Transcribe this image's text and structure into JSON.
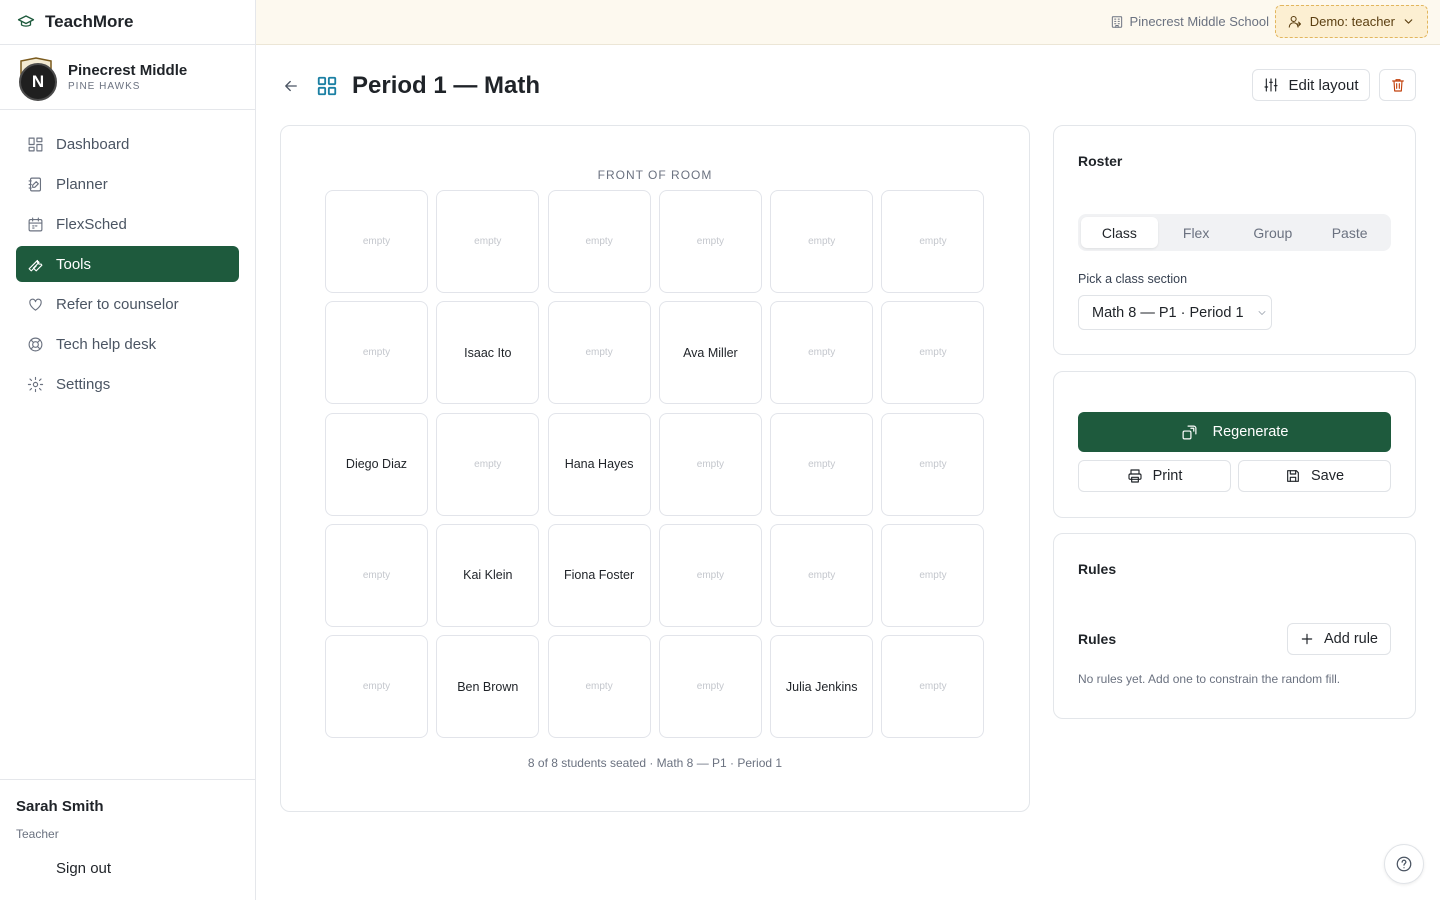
{
  "app": {
    "name": "TeachMore",
    "brand_color": "#1e5a3d",
    "school_name": "Pinecrest Middle",
    "school_subtitle": "PINE HAWKS"
  },
  "sidebar": {
    "items": [
      {
        "label": "Dashboard",
        "icon": "dashboard-icon",
        "active": false
      },
      {
        "label": "Planner",
        "icon": "planner-icon",
        "active": false
      },
      {
        "label": "FlexSched",
        "icon": "calendar-icon",
        "active": false
      },
      {
        "label": "Tools",
        "icon": "wrench-icon",
        "active": true
      },
      {
        "label": "Refer to counselor",
        "icon": "heart-icon",
        "active": false
      },
      {
        "label": "Tech help desk",
        "icon": "lifebuoy-icon",
        "active": false
      },
      {
        "label": "Settings",
        "icon": "gear-icon",
        "active": false
      }
    ],
    "user": {
      "name": "Sarah Smith",
      "role": "Teacher",
      "signout_label": "Sign out",
      "badge": "N"
    }
  },
  "topbar": {
    "school": "Pinecrest Middle School",
    "demo_label": "Demo: teacher"
  },
  "header": {
    "title": "Period 1 — Math",
    "edit_label": "Edit layout"
  },
  "seating": {
    "front_label": "FRONT OF ROOM",
    "empty_label": "empty",
    "columns": 6,
    "seats": [
      "",
      "",
      "",
      "",
      "",
      "",
      "",
      "Isaac Ito",
      "",
      "Ava Miller",
      "",
      "",
      "Diego Diaz",
      "",
      "Hana Hayes",
      "",
      "",
      "",
      "",
      "Kai Klein",
      "Fiona Foster",
      "",
      "",
      "",
      "",
      "Ben Brown",
      "",
      "",
      "Julia Jenkins",
      ""
    ],
    "summary": "8 of 8 students seated · Math 8 — P1 · Period 1"
  },
  "roster": {
    "title": "Roster",
    "tabs": [
      {
        "label": "Class",
        "active": true
      },
      {
        "label": "Flex",
        "active": false
      },
      {
        "label": "Group",
        "active": false
      },
      {
        "label": "Paste",
        "active": false
      }
    ],
    "pick_label": "Pick a class section",
    "selected_section": "Math 8 — P1 · Period 1"
  },
  "actions": {
    "regenerate_label": "Regenerate",
    "print_label": "Print",
    "save_label": "Save"
  },
  "rules": {
    "title": "Rules",
    "subtitle": "Rules",
    "add_label": "Add rule",
    "empty_text": "No rules yet. Add one to constrain the random fill."
  }
}
